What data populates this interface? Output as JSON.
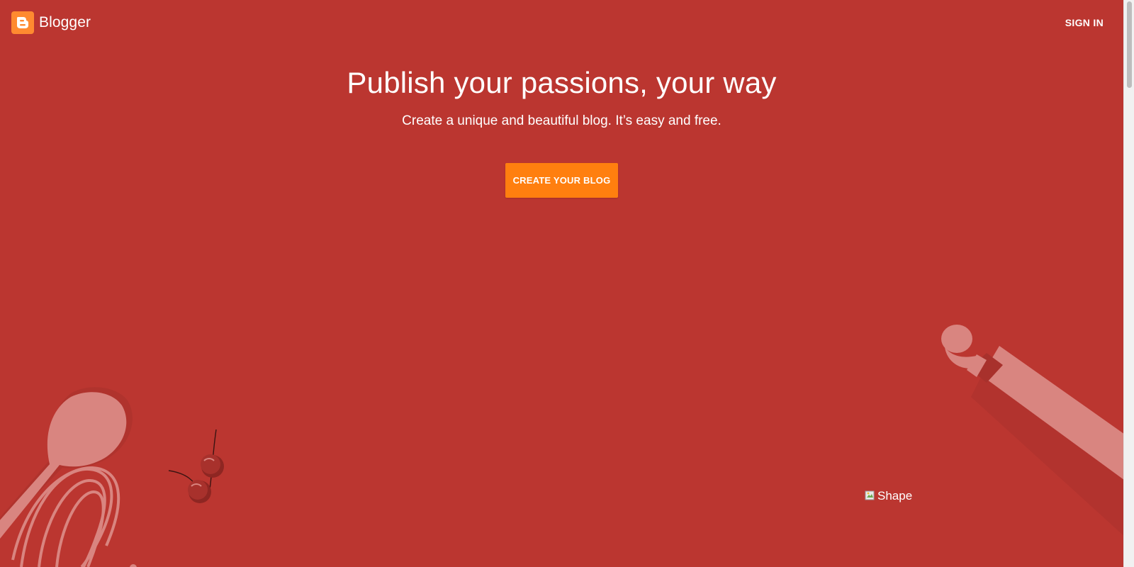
{
  "header": {
    "brand_name": "Blogger",
    "sign_in_label": "SIGN IN"
  },
  "hero": {
    "title": "Publish your passions, your way",
    "subtitle": "Create a unique and beautiful blog. It’s easy and free.",
    "cta_label": "CREATE YOUR BLOG"
  },
  "illustration": {
    "items": [
      "wooden-spoon",
      "whisk",
      "cherries",
      "rolling-pin"
    ],
    "broken_image_alt": "Shape"
  },
  "colors": {
    "background": "#bb3630",
    "accent": "#ff7f0f",
    "logo": "#ff8a30",
    "illustration_light": "#d98580",
    "illustration_dark": "#a8312c"
  },
  "icons": [
    "blogger-logo-icon",
    "broken-image-icon"
  ]
}
